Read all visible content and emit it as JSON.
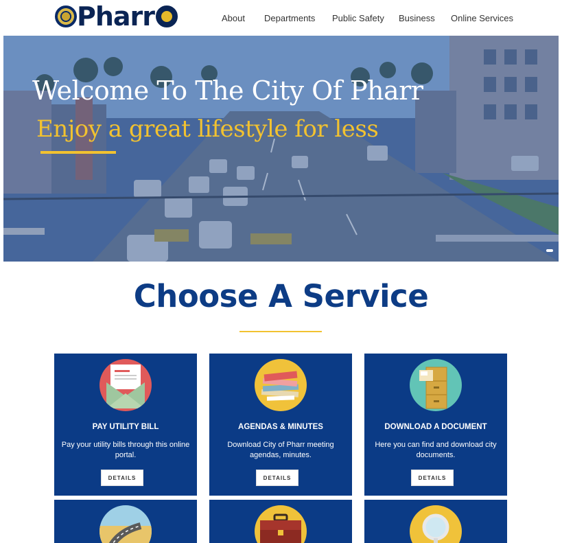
{
  "header": {
    "logo_text": "Pharr",
    "nav": [
      {
        "label": "About"
      },
      {
        "label": "Departments"
      },
      {
        "label": "Public Safety"
      },
      {
        "label": "Business"
      },
      {
        "label": "Online Services"
      }
    ]
  },
  "hero": {
    "title": "Welcome To The City Of Pharr",
    "subtitle": "Enjoy a great lifestyle for less"
  },
  "services": {
    "title": "Choose A Service",
    "cards": [
      {
        "title": "PAY UTILITY BILL",
        "description": "Pay your utility bills through this online portal.",
        "button": "DETAILS",
        "icon": "envelope-icon"
      },
      {
        "title": "AGENDAS & MINUTES",
        "description": "Download City of Pharr meeting agendas, minutes.",
        "button": "DETAILS",
        "icon": "papers-stack-icon"
      },
      {
        "title": "DOWNLOAD A DOCUMENT",
        "description": "Here you can find and download city documents.",
        "button": "DETAILS",
        "icon": "file-cabinet-icon"
      },
      {
        "icon": "road-map-icon"
      },
      {
        "icon": "briefcase-icon"
      },
      {
        "icon": "magnifying-glass-icon"
      }
    ]
  },
  "colors": {
    "brand_navy": "#0b3b86",
    "accent_gold": "#f2c230",
    "title_blue": "#0d3c85"
  }
}
